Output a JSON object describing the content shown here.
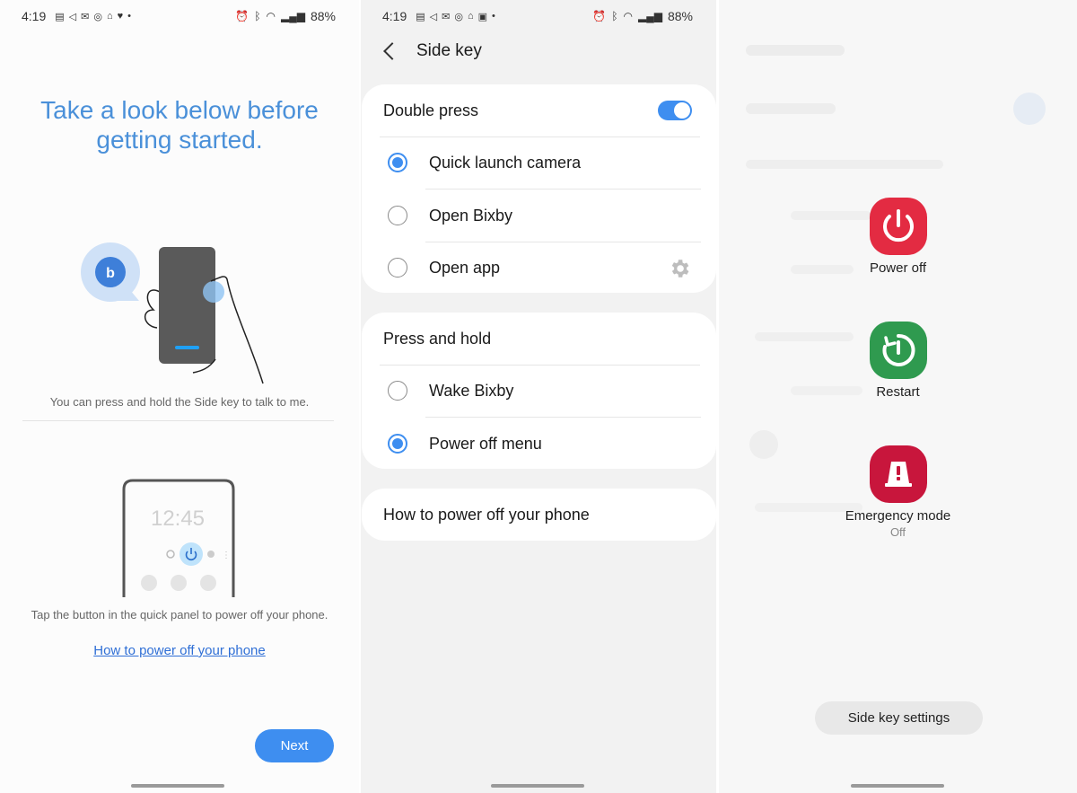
{
  "status_left": {
    "time": "4:19"
  },
  "status_mid": {
    "time": "4:19"
  },
  "status_battery": "88%",
  "onboarding": {
    "title_line1": "Take a look below before",
    "title_line2": "getting started.",
    "caption1": "You can press and hold the Side key to talk to me.",
    "clock": "12:45",
    "caption2": "Tap the button in the quick panel to power off your phone.",
    "link": "How to power off your phone",
    "next": "Next"
  },
  "side_key": {
    "title": "Side key",
    "double_press": {
      "label": "Double press",
      "enabled": true
    },
    "double_options": [
      {
        "label": "Quick launch camera",
        "selected": true
      },
      {
        "label": "Open Bixby",
        "selected": false
      },
      {
        "label": "Open app",
        "selected": false
      }
    ],
    "press_hold": {
      "label": "Press and hold"
    },
    "hold_options": [
      {
        "label": "Wake Bixby",
        "selected": false
      },
      {
        "label": "Power off menu",
        "selected": true
      }
    ],
    "how_to": "How to power off your phone"
  },
  "power_menu": {
    "power_off": "Power off",
    "restart": "Restart",
    "emergency": "Emergency mode",
    "emergency_state": "Off",
    "settings_button": "Side key settings",
    "colors": {
      "power_off": "#e32b42",
      "restart": "#2f9a4f",
      "emergency": "#c8163c"
    }
  },
  "accent_color": "#3e8ef0"
}
